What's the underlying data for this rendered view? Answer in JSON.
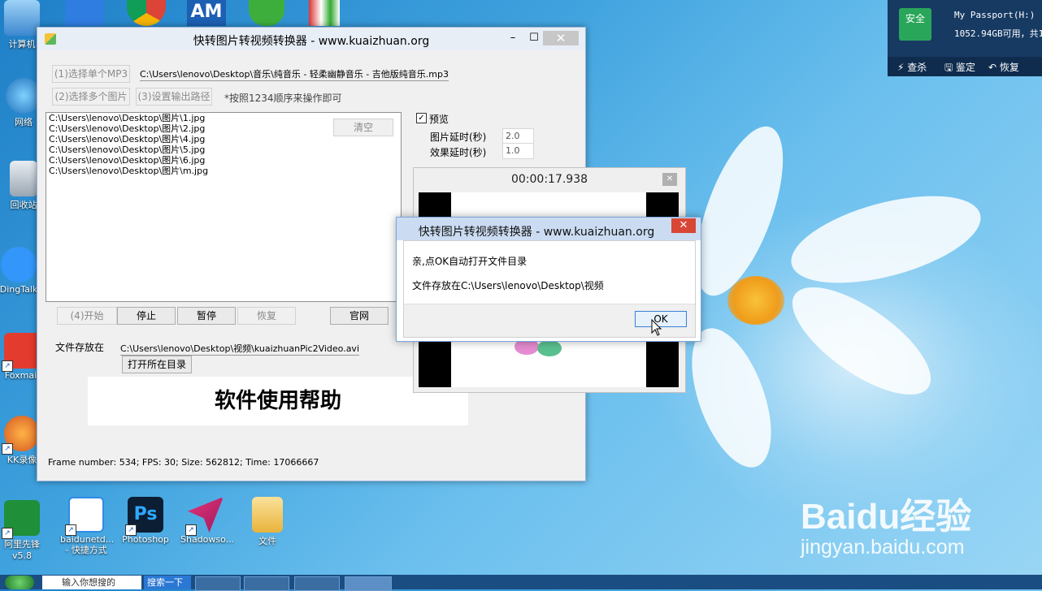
{
  "desktop": {
    "icons": [
      {
        "label": "计算机"
      },
      {
        "label": "网络"
      },
      {
        "label": "回收站"
      },
      {
        "label": "DingTalk"
      },
      {
        "label": "Foxmail"
      },
      {
        "label": "KK录像"
      },
      {
        "label": "阿里先锋v5.8"
      },
      {
        "label": "baidunetd... - 快捷方式"
      },
      {
        "label": "Photoshop"
      },
      {
        "label": "Shadowso..."
      },
      {
        "label": "文件"
      }
    ]
  },
  "window": {
    "title": "快转图片转视频转换器 - www.kuaizhuan.org",
    "select_mp3": "(1)选择单个MP3",
    "mp3_path": "C:\\Users\\lenovo\\Desktop\\音乐\\纯音乐 - 轻柔幽静音乐 - 吉他版纯音乐.mp3",
    "select_images": "(2)选择多个图片",
    "set_output": "(3)设置输出路径",
    "hint": "*按照1234顺序来操作即可",
    "files": [
      "C:\\Users\\lenovo\\Desktop\\图片\\1.jpg",
      "C:\\Users\\lenovo\\Desktop\\图片\\2.jpg",
      "C:\\Users\\lenovo\\Desktop\\图片\\4.jpg",
      "C:\\Users\\lenovo\\Desktop\\图片\\5.jpg",
      "C:\\Users\\lenovo\\Desktop\\图片\\6.jpg",
      "C:\\Users\\lenovo\\Desktop\\图片\\m.jpg"
    ],
    "clear": "清空",
    "preview_label": "预览",
    "image_delay_label": "图片延时(秒)",
    "image_delay_value": "2.0",
    "effect_delay_label": "效果延时(秒)",
    "effect_delay_value": "1.0",
    "start": "(4)开始",
    "stop": "停止",
    "pause": "暂停",
    "resume": "恢复",
    "website": "官网",
    "output_label": "文件存放在",
    "output_path": "C:\\Users\\lenovo\\Desktop\\视频\\kuaizhuanPic2Video.avi",
    "open_dir": "打开所在目录",
    "help": "软件使用帮助",
    "status": "Frame number: 534; FPS: 30; Size: 562812; Time: 17066667"
  },
  "preview": {
    "time": "00:00:17.938"
  },
  "dialog": {
    "title": "快转图片转视频转换器 - www.kuaizhuan.org",
    "line1": "亲,点OK自动打开文件目录",
    "line2": "文件存放在C:\\Users\\lenovo\\Desktop\\视频",
    "ok": "OK"
  },
  "drive_panel": {
    "safe": "安全",
    "name": "My Passport(H:)",
    "free": "1052.94GB可用，共1",
    "actions": [
      "查杀",
      "鉴定",
      "恢复"
    ]
  },
  "taskbar": {
    "search_placeholder": "输入你想搜的",
    "search_button": "搜索一下"
  },
  "watermark": {
    "logo": "Baidu经验",
    "url": "jingyan.baidu.com"
  }
}
